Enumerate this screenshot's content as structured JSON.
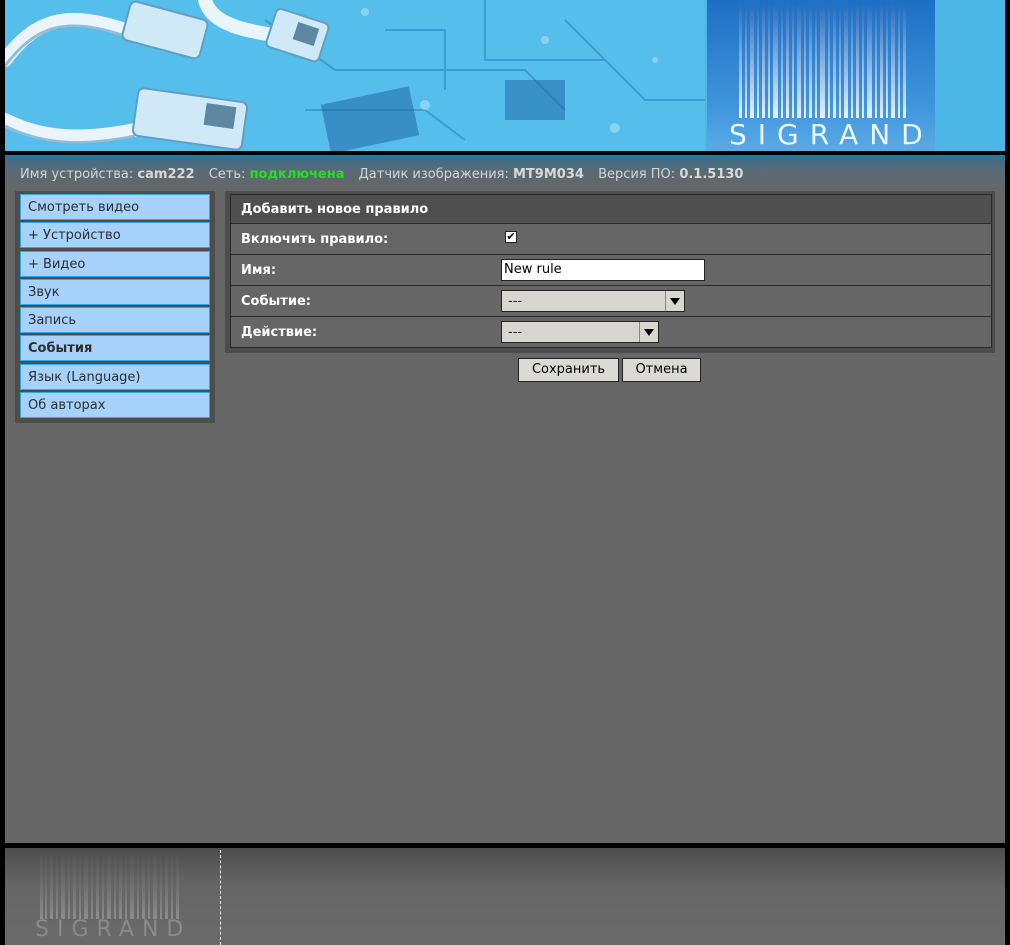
{
  "branding": {
    "logo_text": "SIGRAND",
    "footer_logo_text": "SIGRAND"
  },
  "status": {
    "device_name_label": "Имя устройства:",
    "device_name_value": "cam222",
    "network_label": "Сеть:",
    "network_value": "подключена",
    "sensor_label": "Датчик изображения:",
    "sensor_value": "MT9M034",
    "firmware_label": "Версия ПО:",
    "firmware_value": "0.1.5130",
    "network_status_color": "#22e022"
  },
  "menu": {
    "items": [
      {
        "label": "Смотреть видео"
      },
      {
        "label": "+ Устройство"
      },
      {
        "label": "+ Видео"
      },
      {
        "label": "Звук"
      },
      {
        "label": "Запись"
      },
      {
        "label": "События",
        "active": true
      },
      {
        "label": "Язык (Language)"
      },
      {
        "label": "Об авторах"
      }
    ]
  },
  "form": {
    "title": "Добавить новое правило",
    "enable_label": "Включить правило:",
    "enable_checked": true,
    "name_label": "Имя:",
    "name_value": "New rule",
    "event_label": "Событие:",
    "event_selected": "---",
    "action_label": "Действие:",
    "action_selected": "---",
    "save_button": "Сохранить",
    "cancel_button": "Отмена"
  },
  "colors": {
    "menu_bg": "#a7d2fb",
    "menu_border": "#2aa8f2",
    "page_bg": "#666666",
    "banner_accent": "#2a8fd0"
  }
}
